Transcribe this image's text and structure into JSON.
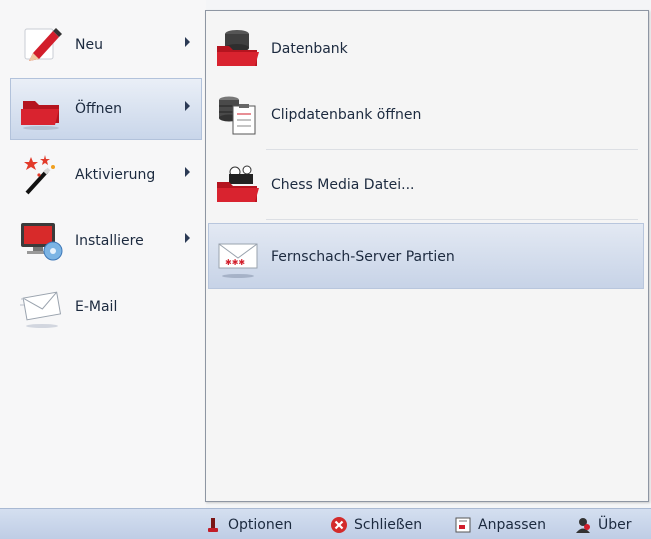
{
  "left_menu": {
    "items": [
      {
        "label": "Neu",
        "icon": "pencil-icon",
        "has_submenu": true
      },
      {
        "label": "Öffnen",
        "icon": "folder-icon",
        "has_submenu": true,
        "selected": true
      },
      {
        "label": "Aktivierung",
        "icon": "magic-wand-icon",
        "has_submenu": true
      },
      {
        "label": "Installiere",
        "icon": "install-monitor-icon",
        "has_submenu": true
      },
      {
        "label": "E-Mail",
        "icon": "envelope-icon",
        "has_submenu": false
      }
    ]
  },
  "submenu": {
    "items": [
      {
        "label": "Datenbank",
        "icon": "database-folder-icon"
      },
      {
        "label": "Clipdatenbank öffnen",
        "icon": "clip-database-icon"
      },
      {
        "label": "Chess Media Datei...",
        "icon": "chess-media-icon"
      },
      {
        "label": "Fernschach-Server Partien",
        "icon": "chess-server-envelope-icon",
        "highlighted": true
      }
    ]
  },
  "footer": {
    "items": [
      {
        "label": "Optionen",
        "icon": "options-icon"
      },
      {
        "label": "Schließen",
        "icon": "close-icon"
      },
      {
        "label": "Anpassen",
        "icon": "customize-icon"
      },
      {
        "label": "Über",
        "icon": "about-icon"
      }
    ]
  },
  "colors": {
    "selection_top": "#eaeff7",
    "selection_bottom": "#c9d6ea",
    "footer_bg": "#c7d4ea",
    "folder_red": "#d21e2b",
    "text": "#1c2a3f"
  }
}
